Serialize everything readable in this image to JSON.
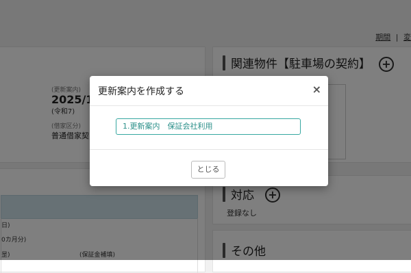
{
  "header": {
    "link_period": "期間",
    "separator": "|",
    "link_truncated": "変"
  },
  "contract": {
    "renewal_caption": "(更新案内)",
    "renewal_year": "2025/1",
    "renewal_era": "(令和7)",
    "lease_caption": "(借家区分)",
    "lease_value": "普通借家契"
  },
  "lower_left": {
    "row1": "日)",
    "row2": "0カ月分)",
    "row3": "昰)",
    "row4_right": "(保証金補填)"
  },
  "related": {
    "title": "関連物件【駐車場の契約】",
    "add_icon": "plus-circle-icon"
  },
  "response": {
    "title": "対応",
    "empty": "登録なし",
    "add_icon": "plus-circle-icon"
  },
  "other": {
    "title": "その他"
  },
  "modal": {
    "title": "更新案内を作成する",
    "close_icon": "×",
    "option_label": "1.更新案内　保証会社利用",
    "close_button": "とじる"
  },
  "colors": {
    "accent_teal": "#36a7a0",
    "overlay": "rgba(0,0,0,0.5)"
  }
}
